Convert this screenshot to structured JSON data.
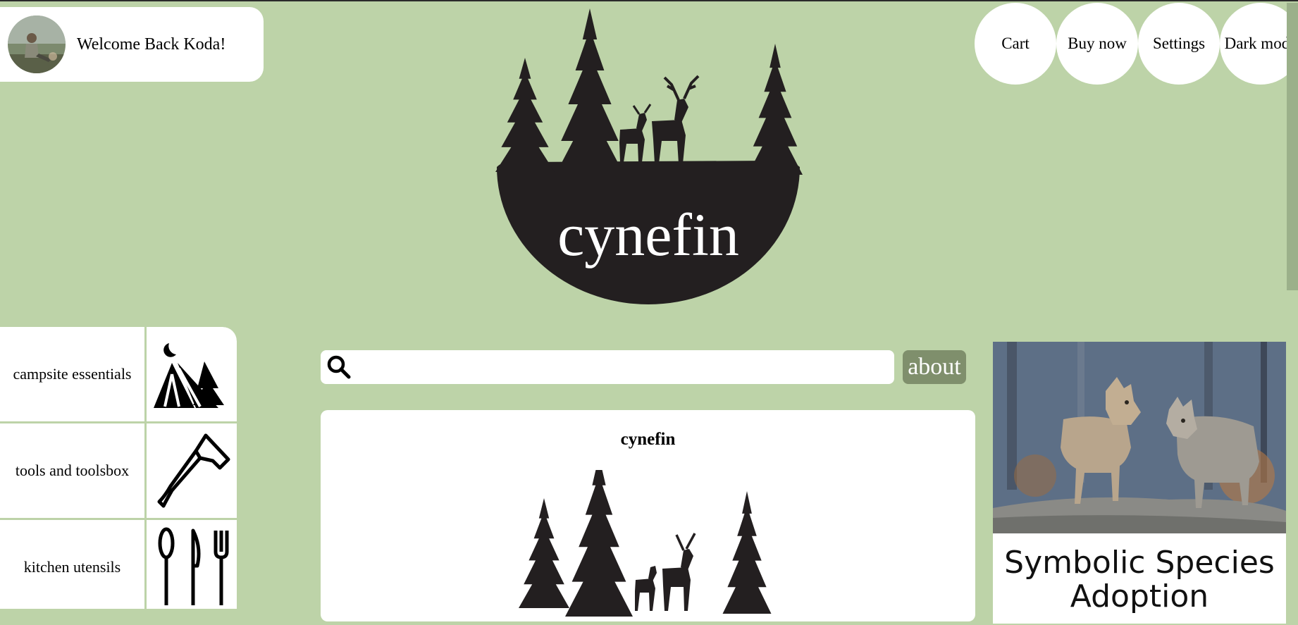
{
  "user": {
    "welcome": "Welcome Back Koda!"
  },
  "nav": {
    "items": [
      "Cart",
      "Buy now",
      "Settings",
      "Dark mode"
    ]
  },
  "logo": {
    "brand": "cynefin"
  },
  "sidebar": {
    "categories": [
      {
        "label": "campsite essentials",
        "icon": "tent-icon"
      },
      {
        "label": "tools and toolsbox",
        "icon": "axe-icon"
      },
      {
        "label": "kitchen utensils",
        "icon": "utensils-icon"
      }
    ]
  },
  "search": {
    "placeholder": "",
    "value": ""
  },
  "about": {
    "label": "about"
  },
  "main": {
    "title": "cynefin"
  },
  "promo": {
    "title": "Symbolic Species Adoption"
  },
  "colors": {
    "background": "#bdd3a8",
    "about_button": "#7f8f6c",
    "logo_fill": "#231f20"
  }
}
